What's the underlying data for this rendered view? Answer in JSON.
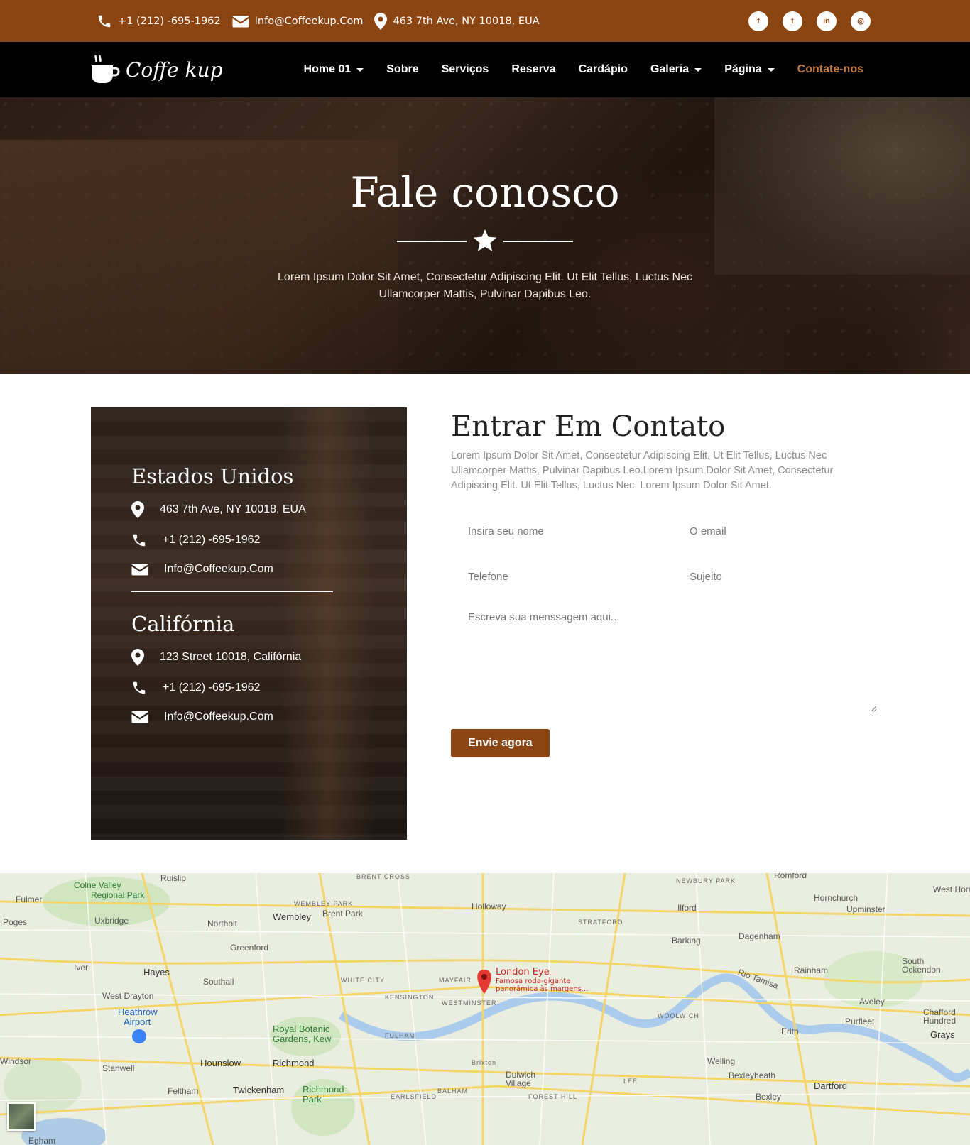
{
  "topbar": {
    "phone": "+1 (212) -695-1962",
    "email": "Info@Coffeekup.Com",
    "address": "463 7th Ave, NY 10018, EUA",
    "socials": [
      {
        "name": "facebook-icon",
        "glyph": "f"
      },
      {
        "name": "twitter-icon",
        "glyph": "t"
      },
      {
        "name": "linkedin-icon",
        "glyph": "in"
      },
      {
        "name": "instagram-icon",
        "glyph": "◎"
      }
    ]
  },
  "nav": {
    "logo_text": "Coffe kup",
    "items": [
      {
        "label": "Home 01",
        "dropdown": true
      },
      {
        "label": "Sobre",
        "dropdown": false
      },
      {
        "label": "Serviços",
        "dropdown": false
      },
      {
        "label": "Reserva",
        "dropdown": false
      },
      {
        "label": "Cardápio",
        "dropdown": false
      },
      {
        "label": "Galeria",
        "dropdown": true
      },
      {
        "label": "Página",
        "dropdown": true
      },
      {
        "label": "Contate-nos",
        "dropdown": false,
        "active": true
      }
    ]
  },
  "hero": {
    "title": "Fale conosco",
    "subtitle": "Lorem Ipsum Dolor Sit Amet, Consectetur Adipiscing Elit. Ut Elit Tellus, Luctus Nec Ullamcorper Mattis, Pulvinar Dapibus Leo."
  },
  "locations": [
    {
      "title": "Estados Unidos",
      "address": "463 7th Ave, NY 10018, EUA",
      "phone": "+1 (212) -695-1962",
      "email": "Info@Coffeekup.Com"
    },
    {
      "title": "Califórnia",
      "address": "123 Street 10018, Califórnia",
      "phone": "+1 (212) -695-1962",
      "email": "Info@Coffeekup.Com"
    }
  ],
  "form": {
    "title": "Entrar Em Contato",
    "description": "Lorem Ipsum Dolor Sit Amet, Consectetur Adipiscing Elit. Ut Elit Tellus, Luctus Nec Ullamcorper Mattis, Pulvinar Dapibus Leo.Lorem Ipsum Dolor Sit Amet, Consectetur Adipiscing Elit. Ut Elit Tellus, Luctus Nec. Lorem Ipsum Dolor Sit Amet.",
    "name_placeholder": "Insira seu nome",
    "email_placeholder": "O email",
    "phone_placeholder": "Telefone",
    "subject_placeholder": "Sujeito",
    "message_placeholder": "Escreva sua menssagem aqui...",
    "submit_label": "Envie agora"
  },
  "map": {
    "pin_title": "London Eye",
    "pin_subtitle_1": "Famosa roda-gigante",
    "pin_subtitle_2": "panorâmica às margens...",
    "labels": [
      {
        "text": "Colne Valley",
        "cls": "park"
      },
      {
        "text": "Regional Park",
        "cls": "park"
      },
      {
        "text": "Ruislip",
        "cls": ""
      },
      {
        "text": "Uxbridge",
        "cls": ""
      },
      {
        "text": "Northolt",
        "cls": ""
      },
      {
        "text": "Wembley",
        "cls": "big"
      },
      {
        "text": "Brent Park",
        "cls": ""
      },
      {
        "text": "Greenford",
        "cls": ""
      },
      {
        "text": "Hayes",
        "cls": "big"
      },
      {
        "text": "Southall",
        "cls": ""
      },
      {
        "text": "West Drayton",
        "cls": ""
      },
      {
        "text": "Heathrow",
        "cls": "big"
      },
      {
        "text": "Airport",
        "cls": "big"
      },
      {
        "text": "Holloway",
        "cls": ""
      },
      {
        "text": "STRATFORD",
        "cls": "small"
      },
      {
        "text": "Ilford",
        "cls": ""
      },
      {
        "text": "Barking",
        "cls": ""
      },
      {
        "text": "Dagenham",
        "cls": ""
      },
      {
        "text": "Romford",
        "cls": ""
      },
      {
        "text": "Hornchurch",
        "cls": ""
      },
      {
        "text": "Upminster",
        "cls": ""
      },
      {
        "text": "Rainham",
        "cls": ""
      },
      {
        "text": "South Ockendon",
        "cls": ""
      },
      {
        "text": "Aveley",
        "cls": ""
      },
      {
        "text": "Purfleet",
        "cls": ""
      },
      {
        "text": "Grays",
        "cls": "big"
      },
      {
        "text": "Chafford Hundred",
        "cls": ""
      },
      {
        "text": "Erith",
        "cls": ""
      },
      {
        "text": "Welling",
        "cls": ""
      },
      {
        "text": "Bexleyheath",
        "cls": ""
      },
      {
        "text": "Bexley",
        "cls": ""
      },
      {
        "text": "Dartford",
        "cls": "big"
      },
      {
        "text": "Royal Botanic",
        "cls": "park"
      },
      {
        "text": "Gardens, Kew",
        "cls": "park"
      },
      {
        "text": "Richmond",
        "cls": ""
      },
      {
        "text": "Hounslow",
        "cls": "big"
      },
      {
        "text": "Twickenham",
        "cls": "big"
      },
      {
        "text": "Richmond Park",
        "cls": "park"
      },
      {
        "text": "Feltham",
        "cls": ""
      },
      {
        "text": "Stanwell",
        "cls": ""
      },
      {
        "text": "Windsor",
        "cls": ""
      },
      {
        "text": "Brixton",
        "cls": "small"
      },
      {
        "text": "Dulwich Village",
        "cls": ""
      },
      {
        "text": "KENSINGTON",
        "cls": "small"
      },
      {
        "text": "WESTMINSTER",
        "cls": "small"
      },
      {
        "text": "MAYFAIR",
        "cls": "small"
      },
      {
        "text": "WHITE CITY",
        "cls": "small"
      },
      {
        "text": "FULHAM",
        "cls": "small"
      },
      {
        "text": "BALHAM",
        "cls": "small"
      },
      {
        "text": "EARLSFIELD",
        "cls": "small"
      },
      {
        "text": "FOREST HILL",
        "cls": "small"
      },
      {
        "text": "WOOLWICH",
        "cls": "small"
      },
      {
        "text": "NEWBURY PARK",
        "cls": "small"
      },
      {
        "text": "WEMBLEY PARK",
        "cls": "small"
      },
      {
        "text": "BRENT CROSS",
        "cls": "small"
      },
      {
        "text": "Fulmer",
        "cls": ""
      },
      {
        "text": "Poges",
        "cls": ""
      },
      {
        "text": "Iver",
        "cls": ""
      },
      {
        "text": "West Horn",
        "cls": ""
      },
      {
        "text": "Rio Tamisa",
        "cls": ""
      },
      {
        "text": "LEE",
        "cls": "small"
      },
      {
        "text": "Egham",
        "cls": ""
      }
    ]
  }
}
